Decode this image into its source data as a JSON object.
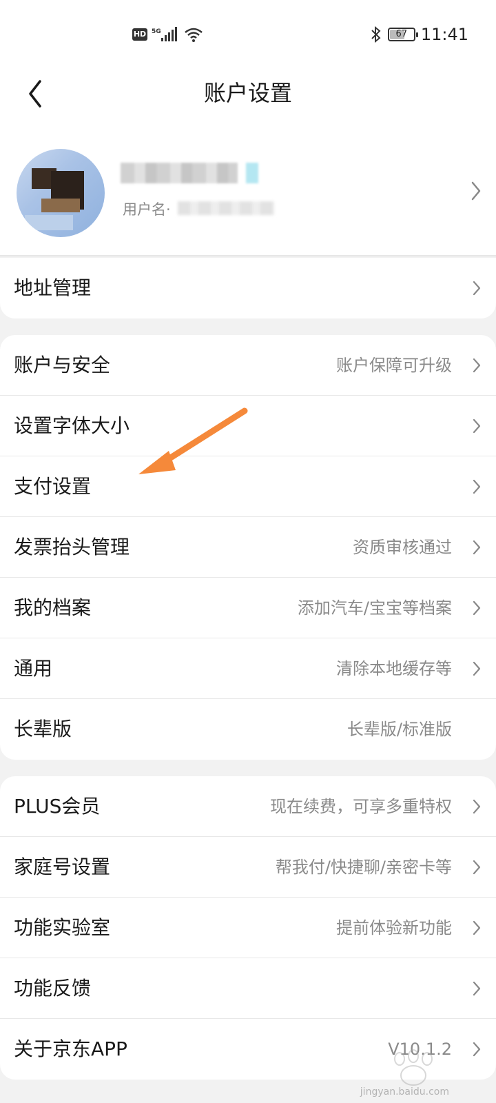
{
  "status_bar": {
    "hd": "HD",
    "network": "5G",
    "battery": "67",
    "time": "11:41",
    "icons": [
      "hd-icon",
      "signal-icon",
      "wifi-icon",
      "bluetooth-icon",
      "battery-icon"
    ]
  },
  "nav": {
    "title": "账户设置",
    "back_icon": "chevron-left-icon"
  },
  "profile": {
    "username_label": "用户名·"
  },
  "sections": [
    {
      "rows": [
        {
          "label": "地址管理",
          "value": ""
        }
      ]
    },
    {
      "rows": [
        {
          "label": "账户与安全",
          "value": "账户保障可升级"
        },
        {
          "label": "设置字体大小",
          "value": ""
        },
        {
          "label": "支付设置",
          "value": ""
        },
        {
          "label": "发票抬头管理",
          "value": "资质审核通过"
        },
        {
          "label": "我的档案",
          "value": "添加汽车/宝宝等档案"
        },
        {
          "label": "通用",
          "value": "清除本地缓存等"
        },
        {
          "label": "长辈版",
          "value": "长辈版/标准版"
        }
      ]
    },
    {
      "rows": [
        {
          "label": "PLUS会员",
          "value": "现在续费，可享多重特权"
        },
        {
          "label": "家庭号设置",
          "value": "帮我付/快捷聊/亲密卡等"
        },
        {
          "label": "功能实验室",
          "value": "提前体验新功能"
        },
        {
          "label": "功能反馈",
          "value": ""
        },
        {
          "label": "关于京东APP",
          "value": "V10.1.2"
        }
      ]
    }
  ],
  "annotation": {
    "arrow_color": "#f5893a"
  },
  "watermark": {
    "text": "jingyan.baidu.com"
  }
}
